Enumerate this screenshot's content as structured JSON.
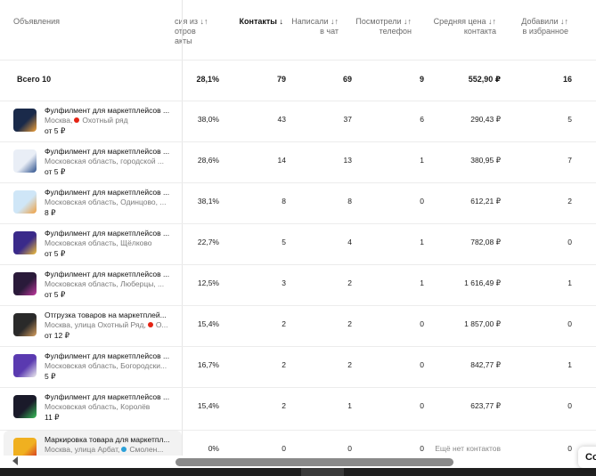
{
  "header": {
    "ads": "Объявления",
    "conversion": [
      "сия из ↓↑",
      "отров",
      "акты"
    ],
    "contacts": "Контакты ↓",
    "wrote": [
      "Написали ↓↑",
      "в чат"
    ],
    "viewed_phone": [
      "Посмотрели ↓↑",
      "телефон"
    ],
    "avg_price": [
      "Средняя цена ↓↑",
      "контакта"
    ],
    "favorites": [
      "Добавили ↓↑",
      "в избранное"
    ]
  },
  "total": {
    "label": "Всего 10",
    "conversion": "28,1%",
    "contacts": "79",
    "wrote": "69",
    "viewed": "9",
    "avg_price": "552,90 ₽",
    "favorites": "16"
  },
  "rows": [
    {
      "title": "Фулфилмент для маркетплейсов ...",
      "location": "Москва,",
      "metro": "Охотный ряд",
      "metro_color": "#e42313",
      "price": "от 5 ₽",
      "conversion": "38,0%",
      "contacts": "43",
      "wrote": "37",
      "viewed": "6",
      "avg_price": "290,43 ₽",
      "favorites": "5",
      "thumb_colors": [
        "#1a2a4a",
        "#f2a23a"
      ]
    },
    {
      "title": "Фулфилмент для маркетплейсов ...",
      "location": "Московская область, городской ...",
      "metro": "",
      "metro_color": "",
      "price": "от 5 ₽",
      "conversion": "28,6%",
      "contacts": "14",
      "wrote": "13",
      "viewed": "1",
      "avg_price": "380,95 ₽",
      "favorites": "7",
      "thumb_colors": [
        "#e9eef6",
        "#2b4f8c"
      ]
    },
    {
      "title": "Фулфилмент для маркетплейсов ...",
      "location": "Московская область, Одинцово, ...",
      "metro": "",
      "metro_color": "",
      "price": "8 ₽",
      "conversion": "38,1%",
      "contacts": "8",
      "wrote": "8",
      "viewed": "0",
      "avg_price": "612,21 ₽",
      "favorites": "2",
      "thumb_colors": [
        "#cfe6f7",
        "#f0a040"
      ]
    },
    {
      "title": "Фулфилмент для маркетплейсов ...",
      "location": "Московская область, Щёлково",
      "metro": "",
      "metro_color": "",
      "price": "от 5 ₽",
      "conversion": "22,7%",
      "contacts": "5",
      "wrote": "4",
      "viewed": "1",
      "avg_price": "782,08 ₽",
      "favorites": "0",
      "thumb_colors": [
        "#3a2a8a",
        "#f3c23a"
      ]
    },
    {
      "title": "Фулфилмент для маркетплейсов ...",
      "location": "Московская область, Люберцы, ...",
      "metro": "",
      "metro_color": "",
      "price": "от 5 ₽",
      "conversion": "12,5%",
      "contacts": "3",
      "wrote": "2",
      "viewed": "1",
      "avg_price": "1 616,49 ₽",
      "favorites": "1",
      "thumb_colors": [
        "#2a1a3a",
        "#c23aa0"
      ]
    },
    {
      "title": "Отгрузка товаров на маркетплей...",
      "location": "Москва, улица Охотный Ряд,",
      "metro": "О...",
      "metro_color": "#e42313",
      "price": "от 12 ₽",
      "conversion": "15,4%",
      "contacts": "2",
      "wrote": "2",
      "viewed": "0",
      "avg_price": "1 857,00 ₽",
      "favorites": "0",
      "thumb_colors": [
        "#2a2a2a",
        "#d8a060"
      ]
    },
    {
      "title": "Фулфилмент для маркетплейсов ...",
      "location": "Московская область, Богородски...",
      "metro": "",
      "metro_color": "",
      "price": "5 ₽",
      "conversion": "16,7%",
      "contacts": "2",
      "wrote": "2",
      "viewed": "0",
      "avg_price": "842,77 ₽",
      "favorites": "1",
      "thumb_colors": [
        "#5a3ab0",
        "#f0f0f0"
      ]
    },
    {
      "title": "Фулфилмент для маркетплейсов ...",
      "location": "Московская область, Королёв",
      "metro": "",
      "metro_color": "",
      "price": "11 ₽",
      "conversion": "15,4%",
      "contacts": "2",
      "wrote": "1",
      "viewed": "0",
      "avg_price": "623,77 ₽",
      "favorites": "0",
      "thumb_colors": [
        "#1a1a2a",
        "#3ac05a"
      ]
    },
    {
      "title": "Маркировка товара для маркетпл...",
      "location": "Москва, улица Арбат,",
      "metro": "Смолен...",
      "metro_color": "#2aa0d8",
      "price": "",
      "conversion": "0%",
      "contacts": "0",
      "wrote": "0",
      "viewed": "0",
      "avg_price": "Ещё нет контактов",
      "favorites": "0",
      "thumb_colors": [
        "#f0b020",
        "#d02020"
      ]
    }
  ],
  "popup_text": "Co"
}
